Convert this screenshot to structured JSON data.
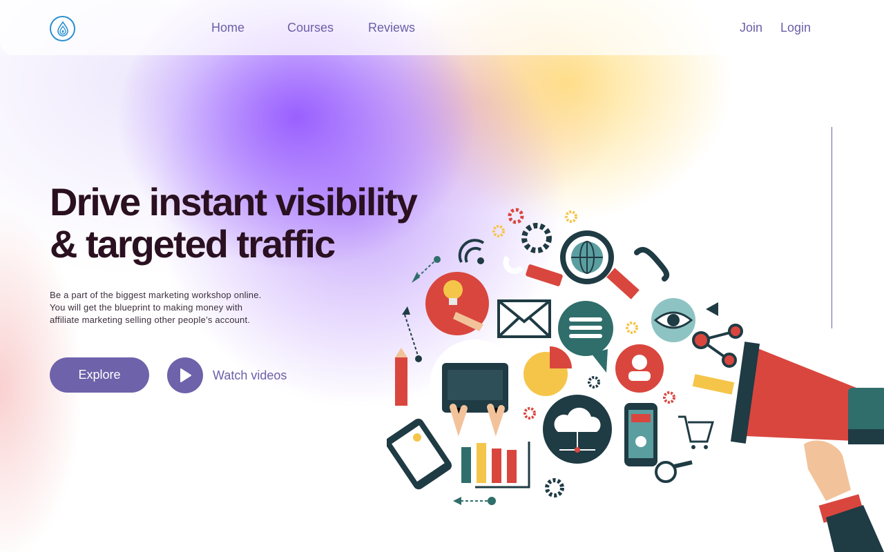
{
  "nav": {
    "links": [
      {
        "label": "Home"
      },
      {
        "label": "Courses"
      },
      {
        "label": "Reviews"
      }
    ],
    "join_label": "Join",
    "login_label": "Login",
    "logo_icon": "water-drop-icon"
  },
  "hero": {
    "title_lines": [
      "Drive instant visibility",
      "& targeted traffic"
    ],
    "description_lines": [
      "Be a part of the biggest marketing workshop online.",
      "You will get the blueprint to making money with",
      "affiliate marketing selling other people’s account."
    ],
    "explore_label": "Explore",
    "watch_label": "Watch videos",
    "play_icon": "play-icon"
  },
  "illustration": {
    "icons": [
      "lightbulb-icon",
      "envelope-icon",
      "globe-magnifier-icon",
      "chat-bubble-icon",
      "eye-icon",
      "person-icon",
      "megaphone-icon",
      "laptop-icon",
      "pie-chart-icon",
      "cloud-icon",
      "smartphone-icon",
      "shopping-cart-icon",
      "bar-chart-icon",
      "tablet-icon",
      "gear-icon",
      "phone-handset-icon",
      "wifi-icon",
      "share-icon",
      "pencil-icon",
      "magnifier-icon"
    ]
  },
  "colors": {
    "accent": "#6e62aa",
    "title": "#2a1020",
    "red": "#d9463e",
    "teal": "#2f6e6a",
    "dark": "#1f3b44",
    "yellow": "#f5c54a"
  }
}
